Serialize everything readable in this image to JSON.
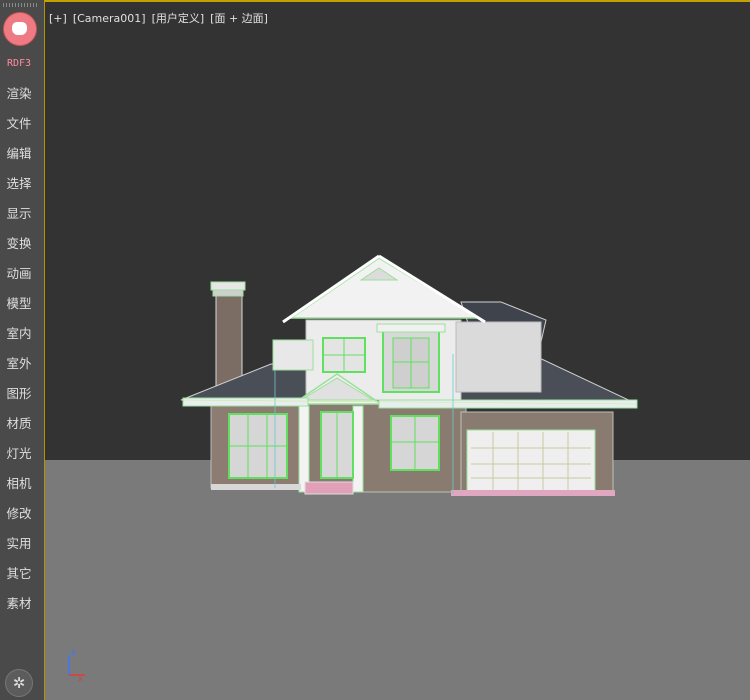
{
  "app": {
    "brand": "RDF3"
  },
  "sidebar": {
    "items": [
      {
        "label": "渲染"
      },
      {
        "label": "文件"
      },
      {
        "label": "编辑"
      },
      {
        "label": "选择"
      },
      {
        "label": "显示"
      },
      {
        "label": "变换"
      },
      {
        "label": "动画"
      },
      {
        "label": "模型"
      },
      {
        "label": "室内"
      },
      {
        "label": "室外"
      },
      {
        "label": "图形"
      },
      {
        "label": "材质"
      },
      {
        "label": "灯光"
      },
      {
        "label": "相机"
      },
      {
        "label": "修改"
      },
      {
        "label": "实用"
      },
      {
        "label": "其它"
      },
      {
        "label": "素材"
      }
    ]
  },
  "viewport": {
    "menu_plus": "[+]",
    "camera": "[Camera001]",
    "view_mode": "[用户定义]",
    "shading": "[面 + 边面]",
    "axis_z": "z",
    "axis_x": "x"
  },
  "colors": {
    "viewport_bg": "#333333",
    "ground": "#7a7a7a",
    "active_border": "#c4a000",
    "brand_pink": "#ff8a9c"
  }
}
